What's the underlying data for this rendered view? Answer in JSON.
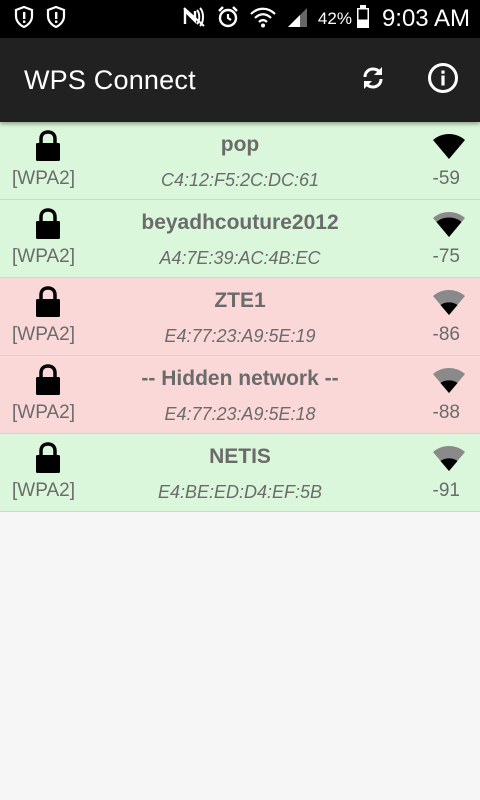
{
  "status_bar": {
    "left_icons": [
      "shield-alert-icon",
      "shield-alert-icon"
    ],
    "right_icons": [
      "nfc-muted-icon",
      "alarm-icon",
      "wifi-icon",
      "cell-signal-icon",
      "battery-icon"
    ],
    "battery": "42%",
    "time": "9:03 AM"
  },
  "app_bar": {
    "title": "WPS Connect",
    "actions": [
      "refresh-icon",
      "info-icon"
    ]
  },
  "colors": {
    "good_row": "#dbf7db",
    "bad_row": "#fbd8d8",
    "app_bar": "#212121"
  },
  "networks": [
    {
      "ssid": "pop",
      "bssid": "C4:12:F5:2C:DC:61",
      "security": "[WPA2]",
      "level": "-59",
      "status": "good",
      "signal_bars": 4
    },
    {
      "ssid": "beyadhcouture2012",
      "bssid": "A4:7E:39:AC:4B:EC",
      "security": "[WPA2]",
      "level": "-75",
      "status": "good",
      "signal_bars": 3
    },
    {
      "ssid": "ZTE1",
      "bssid": "E4:77:23:A9:5E:19",
      "security": "[WPA2]",
      "level": "-86",
      "status": "bad",
      "signal_bars": 2
    },
    {
      "ssid": "-- Hidden network --",
      "bssid": "E4:77:23:A9:5E:18",
      "security": "[WPA2]",
      "level": "-88",
      "status": "bad",
      "signal_bars": 2
    },
    {
      "ssid": "NETIS",
      "bssid": "E4:BE:ED:D4:EF:5B",
      "security": "[WPA2]",
      "level": "-91",
      "status": "good",
      "signal_bars": 2
    }
  ]
}
